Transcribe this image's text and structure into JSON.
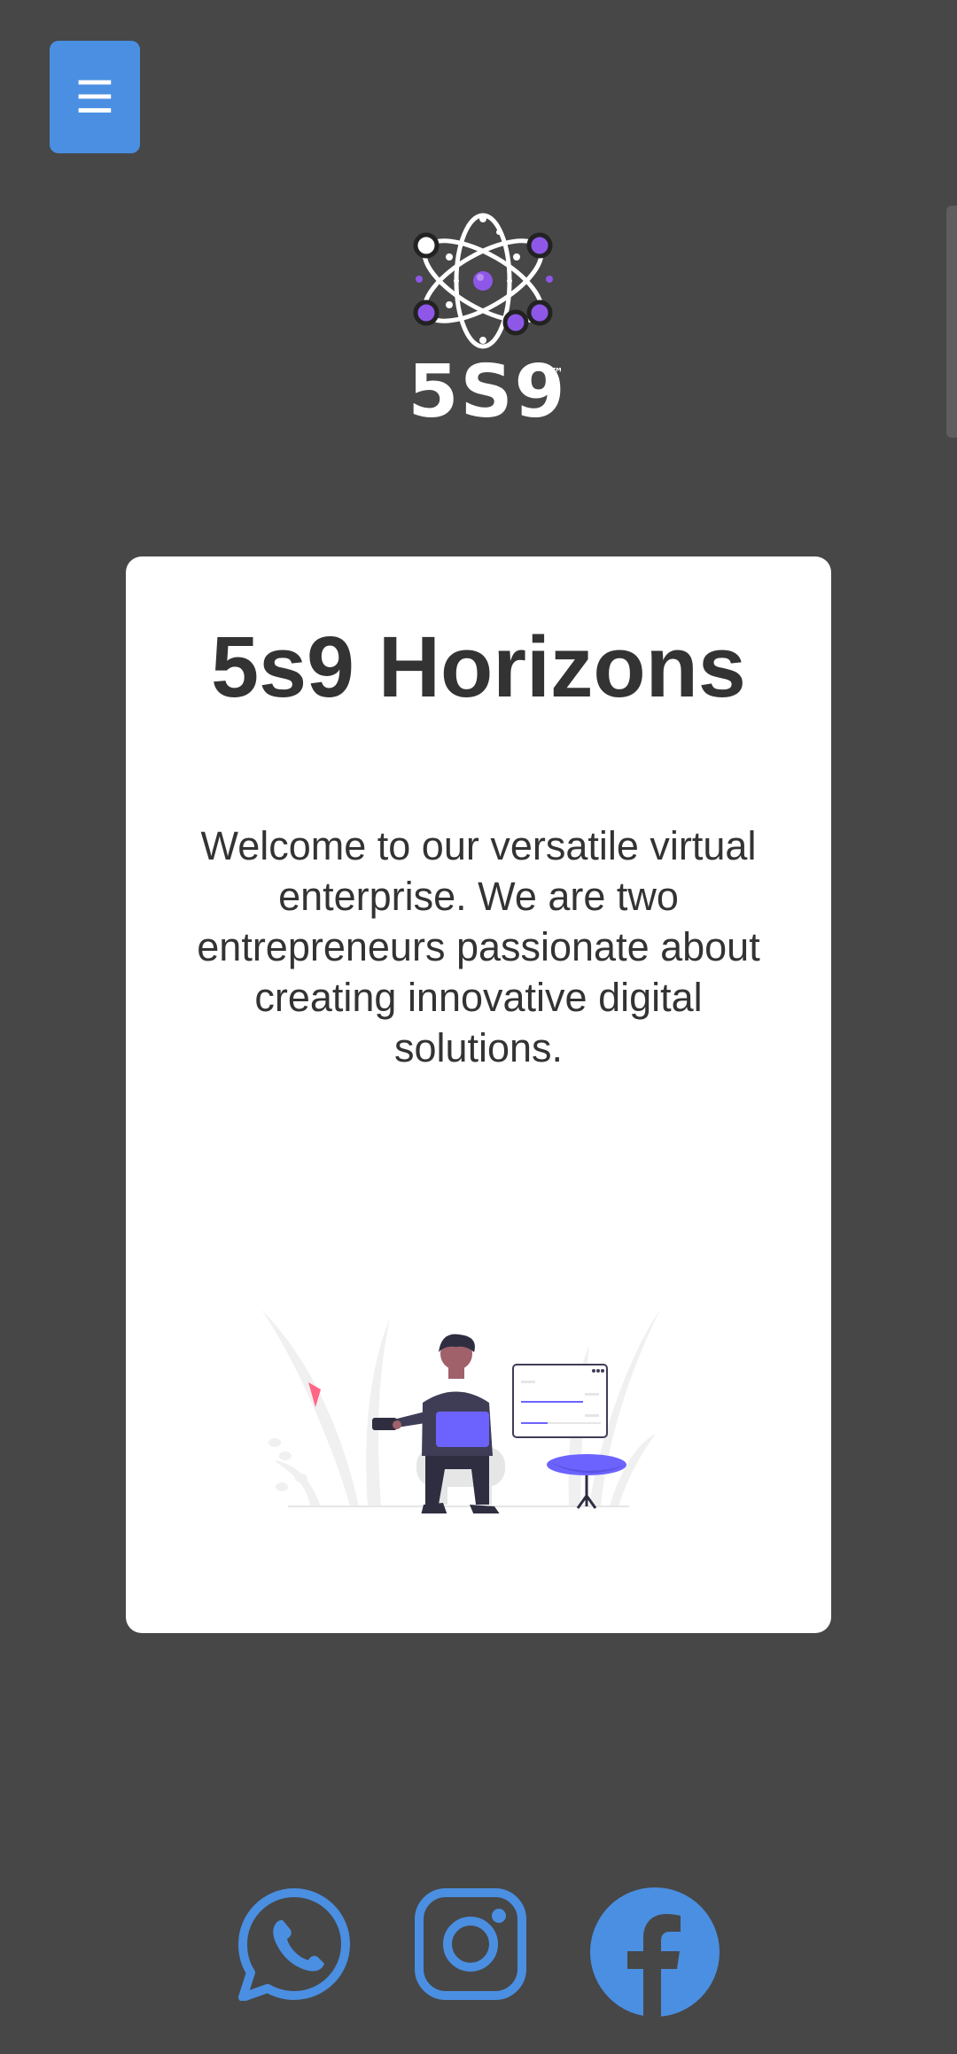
{
  "header": {
    "menu_icon": "☰",
    "logo_text": "5S9",
    "logo_tm": "™"
  },
  "card": {
    "title": "5s9 Horizons",
    "description": "Welcome to our versatile virtual enterprise. We are two entrepreneurs passionate about creating innovative digital solutions."
  },
  "social": {
    "items": [
      "whatsapp-icon",
      "instagram-icon",
      "facebook-icon"
    ]
  },
  "colors": {
    "background": "#474747",
    "accent": "#4a8fe2",
    "card": "#ffffff",
    "purple": "#8e57e8",
    "illustration_accent": "#6c63ff"
  }
}
